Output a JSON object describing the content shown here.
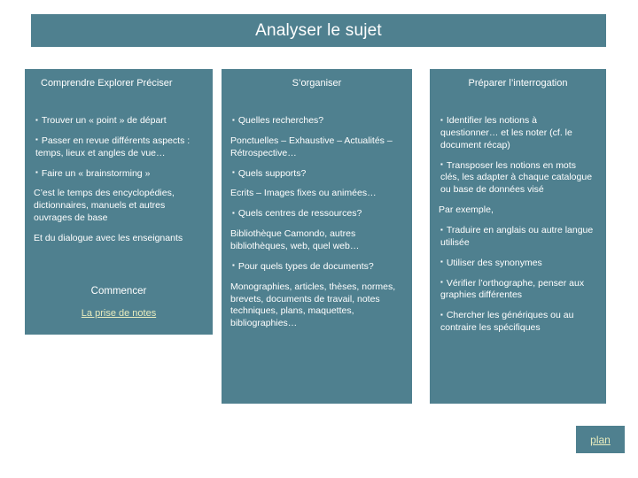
{
  "slide": {
    "title": "Analyser le sujet",
    "accent_color": "#4f808f",
    "text_color": "#ffffff",
    "link_color": "#e8ecbf",
    "background_color": "#ffffff"
  },
  "columns": [
    {
      "header": "Comprendre Explorer Préciser",
      "lines": [
        {
          "bullet": true,
          "text": "Trouver un « point » de départ"
        },
        {
          "bullet": true,
          "text": "Passer en revue différents aspects : temps, lieux et angles de vue…"
        },
        {
          "bullet": true,
          "text": "Faire un « brainstorming »"
        },
        {
          "bullet": false,
          "text": "C’est le temps des encyclopédies, dictionnaires, manuels et autres ouvrages de base"
        },
        {
          "bullet": false,
          "text": "Et du dialogue avec les enseignants"
        }
      ]
    },
    {
      "header": "S’organiser",
      "lines": [
        {
          "bullet": true,
          "text": "Quelles recherches?"
        },
        {
          "bullet": false,
          "text": "Ponctuelles – Exhaustive – Actualités – Rétrospective…"
        },
        {
          "bullet": true,
          "text": "Quels supports?"
        },
        {
          "bullet": false,
          "text": "Ecrits – Images fixes ou animées…"
        },
        {
          "bullet": true,
          "text": "Quels centres de ressources?"
        },
        {
          "bullet": false,
          "text": "Bibliothèque Camondo, autres bibliothèques, web, quel web…"
        },
        {
          "bullet": true,
          "text": "Pour quels types de documents?"
        },
        {
          "bullet": false,
          "text": "Monographies, articles, thèses, normes, brevets, documents de travail, notes techniques, plans, maquettes, bibliographies…"
        }
      ]
    },
    {
      "header": "Préparer l’interrogation",
      "lines": [
        {
          "bullet": true,
          "text": "Identifier les notions à questionner… et les noter (cf. le document récap)"
        },
        {
          "bullet": true,
          "text": "Transposer les notions en mots clés, les adapter à chaque catalogue ou base de données visé"
        },
        {
          "bullet": false,
          "text": "Par exemple,"
        },
        {
          "bullet": true,
          "text": "Traduire en anglais ou autre langue utilisée"
        },
        {
          "bullet": true,
          "text": "Utiliser des synonymes"
        },
        {
          "bullet": true,
          "text": "Vérifier l’orthographe, penser aux graphies différentes"
        },
        {
          "bullet": true,
          "text": "Chercher les génériques ou au contraire les spécifiques"
        }
      ]
    }
  ],
  "commencer": {
    "label": "Commencer",
    "link_label": "La prise de notes"
  },
  "plan": {
    "label": "plan"
  }
}
